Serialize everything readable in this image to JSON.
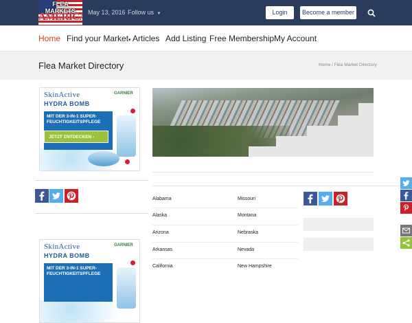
{
  "header": {
    "logo_line1": "FLEA MARKETS",
    "logo_line2": "AMERICA",
    "date": "May 13, 2016",
    "follow_label": "Follow us",
    "login_label": "Login",
    "member_label": "Become a member"
  },
  "nav": {
    "items": [
      "Home",
      "Find your Market",
      "Articles",
      "Add Listing",
      "Free Membership",
      "My Account"
    ]
  },
  "page": {
    "title": "Flea Market Directory",
    "breadcrumb": "Home  /  Flea Market Directory"
  },
  "ad": {
    "brand": "SkinActive",
    "product": "HYDRA BOMB",
    "maker": "GARNIER",
    "tagline": "MIT DER 3-IN-1 SUPER-FEUCHTIGKEITSPFLEGE",
    "cta": "JETZT ENTDECKEN"
  },
  "states": {
    "left": [
      "Alabama",
      "Alaska",
      "Arizona",
      "Arkansas",
      "California"
    ],
    "right": [
      "Missouri",
      "Montana",
      "Nebraska",
      "Nevada",
      "New Hampshire"
    ]
  },
  "share_icons": [
    "facebook-icon",
    "twitter-icon",
    "pinterest-icon"
  ],
  "floating_share_icons": [
    "twitter-icon",
    "facebook-icon",
    "pinterest-icon",
    "email-icon",
    "share-more-icon"
  ],
  "colors": {
    "header_bg": "#2a3b5c",
    "nav_active": "#d9431e",
    "facebook": "#3b5998",
    "twitter": "#55acee",
    "pinterest": "#cb2027",
    "email": "#777777",
    "share_more": "#95c23d"
  }
}
